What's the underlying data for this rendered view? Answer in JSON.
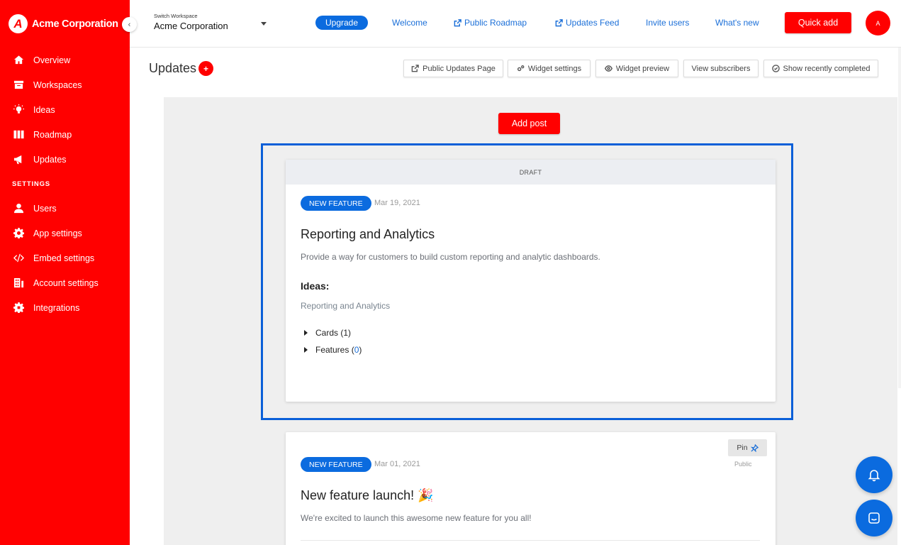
{
  "brand": {
    "name": "Acme Corporation",
    "logo_letter": "A"
  },
  "sidebar": {
    "items": [
      {
        "label": "Overview",
        "icon": "home-icon"
      },
      {
        "label": "Workspaces",
        "icon": "archive-icon"
      },
      {
        "label": "Ideas",
        "icon": "lightbulb-icon"
      },
      {
        "label": "Roadmap",
        "icon": "columns-icon"
      },
      {
        "label": "Updates",
        "icon": "megaphone-icon"
      }
    ],
    "settings_heading": "SETTINGS",
    "settings_items": [
      {
        "label": "Users",
        "icon": "user-icon"
      },
      {
        "label": "App settings",
        "icon": "gear-icon"
      },
      {
        "label": "Embed settings",
        "icon": "code-icon"
      },
      {
        "label": "Account settings",
        "icon": "building-icon"
      },
      {
        "label": "Integrations",
        "icon": "cog-plug-icon"
      }
    ]
  },
  "topbar": {
    "switch_label": "Switch Workspace",
    "workspace_name": "Acme Corporation",
    "upgrade": "Upgrade",
    "links": {
      "welcome": "Welcome",
      "public_roadmap": "Public Roadmap",
      "updates_feed": "Updates Feed",
      "invite_users": "Invite users",
      "whats_new": "What's new"
    },
    "quick_add": "Quick add",
    "avatar_letter": "A"
  },
  "page": {
    "title": "Updates",
    "title_add": "+",
    "buttons": {
      "public_updates_page": "Public Updates Page",
      "widget_settings": "Widget settings",
      "widget_preview": "Widget preview",
      "view_subscribers": "View subscribers",
      "show_recently_completed": "Show recently completed"
    },
    "add_post": "Add post"
  },
  "posts": [
    {
      "status": "DRAFT",
      "badge": "NEW FEATURE",
      "date": "Mar 19, 2021",
      "title": "Reporting and Analytics",
      "description": "Provide a way for customers to build custom reporting and analytic dashboards.",
      "ideas_heading": "Ideas:",
      "idea_link": "Reporting and Analytics",
      "cards_label": "Cards (1)",
      "features_prefix": "Features (",
      "features_count": "0",
      "features_suffix": ")"
    },
    {
      "badge": "NEW FEATURE",
      "date": "Mar 01, 2021",
      "title": "New feature launch! 🎉",
      "description": "We're excited to launch this awesome new feature for you all!",
      "pin": "Pin",
      "visibility": "Public"
    }
  ],
  "colors": {
    "brand_red": "#ff0000",
    "accent_blue": "#0b6bdf",
    "highlight_blue": "#0a5fd8"
  }
}
